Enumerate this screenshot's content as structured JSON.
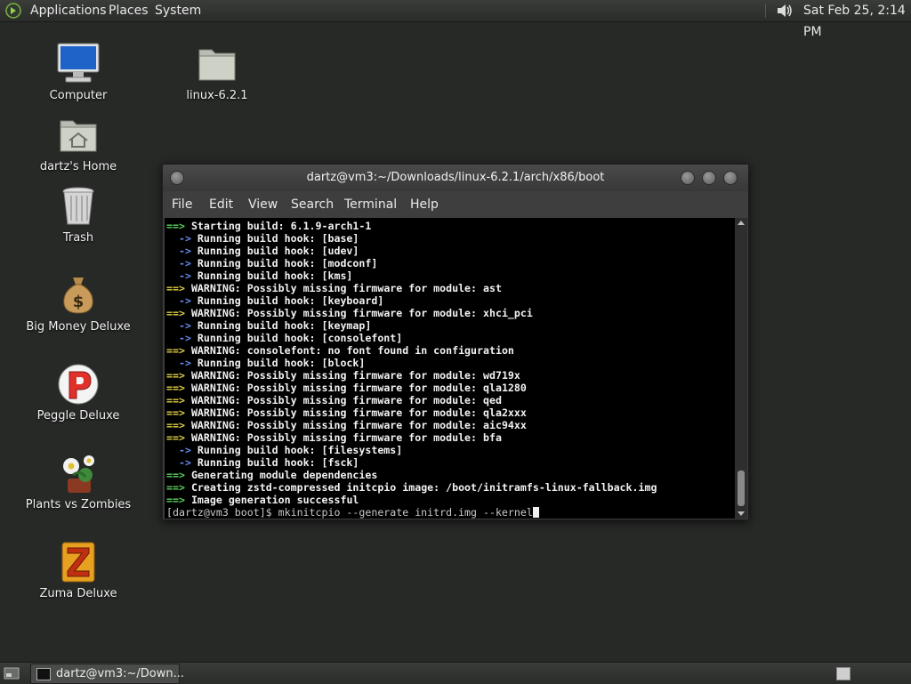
{
  "top_panel": {
    "menus": [
      "Applications",
      "Places",
      "System"
    ],
    "clock": "Sat Feb 25, 2:14 PM"
  },
  "desktop_icons": [
    {
      "label": "Computer",
      "icon": "computer-icon"
    },
    {
      "label": "linux-6.2.1",
      "icon": "folder-icon"
    },
    {
      "label": "dartz's Home",
      "icon": "home-folder-icon"
    },
    {
      "label": "Trash",
      "icon": "trash-icon"
    },
    {
      "label": "Big Money Deluxe",
      "icon": "money-bag-icon"
    },
    {
      "label": "Peggle Deluxe",
      "icon": "peggle-icon"
    },
    {
      "label": "Plants vs Zombies",
      "icon": "plant-icon"
    },
    {
      "label": "Zuma Deluxe",
      "icon": "zuma-icon"
    }
  ],
  "terminal": {
    "title": "dartz@vm3:~/Downloads/linux-6.2.1/arch/x86/boot",
    "menu": [
      "File",
      "Edit",
      "View",
      "Search",
      "Terminal",
      "Help"
    ],
    "lines": [
      {
        "arrow": "==>",
        "kind": "g",
        "text": "Starting build: 6.1.9-arch1-1"
      },
      {
        "arrow": "  ->",
        "kind": "b",
        "text": "Running build hook: [base]"
      },
      {
        "arrow": "  ->",
        "kind": "b",
        "text": "Running build hook: [udev]"
      },
      {
        "arrow": "  ->",
        "kind": "b",
        "text": "Running build hook: [modconf]"
      },
      {
        "arrow": "  ->",
        "kind": "b",
        "text": "Running build hook: [kms]"
      },
      {
        "arrow": "==>",
        "kind": "y",
        "text": "WARNING: Possibly missing firmware for module: ast"
      },
      {
        "arrow": "  ->",
        "kind": "b",
        "text": "Running build hook: [keyboard]"
      },
      {
        "arrow": "==>",
        "kind": "y",
        "text": "WARNING: Possibly missing firmware for module: xhci_pci"
      },
      {
        "arrow": "  ->",
        "kind": "b",
        "text": "Running build hook: [keymap]"
      },
      {
        "arrow": "  ->",
        "kind": "b",
        "text": "Running build hook: [consolefont]"
      },
      {
        "arrow": "==>",
        "kind": "y",
        "text": "WARNING: consolefont: no font found in configuration"
      },
      {
        "arrow": "  ->",
        "kind": "b",
        "text": "Running build hook: [block]"
      },
      {
        "arrow": "==>",
        "kind": "y",
        "text": "WARNING: Possibly missing firmware for module: wd719x"
      },
      {
        "arrow": "==>",
        "kind": "y",
        "text": "WARNING: Possibly missing firmware for module: qla1280"
      },
      {
        "arrow": "==>",
        "kind": "y",
        "text": "WARNING: Possibly missing firmware for module: qed"
      },
      {
        "arrow": "==>",
        "kind": "y",
        "text": "WARNING: Possibly missing firmware for module: qla2xxx"
      },
      {
        "arrow": "==>",
        "kind": "y",
        "text": "WARNING: Possibly missing firmware for module: aic94xx"
      },
      {
        "arrow": "==>",
        "kind": "y",
        "text": "WARNING: Possibly missing firmware for module: bfa"
      },
      {
        "arrow": "  ->",
        "kind": "b",
        "text": "Running build hook: [filesystems]"
      },
      {
        "arrow": "  ->",
        "kind": "b",
        "text": "Running build hook: [fsck]"
      },
      {
        "arrow": "==>",
        "kind": "g",
        "text": "Generating module dependencies"
      },
      {
        "arrow": "==>",
        "kind": "g",
        "text": "Creating zstd-compressed initcpio image: /boot/initramfs-linux-fallback.img"
      },
      {
        "arrow": "==>",
        "kind": "g",
        "text": "Image generation successful"
      }
    ],
    "prompt": "[dartz@vm3 boot]$ ",
    "command": "mkinitcpio --generate initrd.img --kernel"
  },
  "bottom_panel": {
    "task_label": "dartz@vm3:~/Down..."
  },
  "colors": {
    "arrow_ok": "#5ad25a",
    "arrow_warn": "#e0d040",
    "arrow_sub": "#6a8cf0",
    "desktop_bg": "#272927"
  }
}
